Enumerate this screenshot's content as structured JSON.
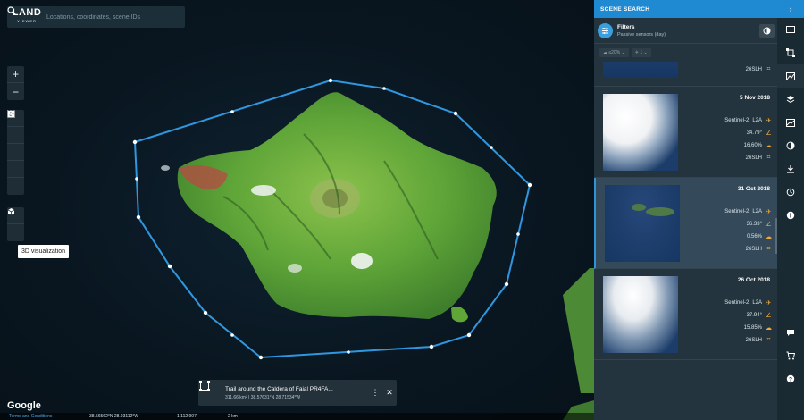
{
  "search": {
    "placeholder": "Locations, coordinates, scene IDs",
    "logo_main": "LAND",
    "logo_sub": "VIEWER"
  },
  "tooltip": "3D visualization",
  "map": {
    "google": "Google",
    "terms": "Terms and Conditions",
    "coords": "38.56562°N 28.93112°W",
    "scale": "1:112 907",
    "distance": "2 km"
  },
  "infocard": {
    "title": "Trail around the Caldera of Faial PR4FA...",
    "detail": "311.66 km² | 38.57631°N 28.71534°W"
  },
  "panel": {
    "title": "SCENE SEARCH",
    "filters_title": "Filters",
    "filters_sub": "Passive sensors (day)",
    "chip_cloud": "≤20%",
    "chip_sat": "1"
  },
  "scenes": [
    {
      "date": "",
      "tile": "26SLH"
    },
    {
      "date": "5 Nov 2018",
      "sensor": "Sentinel-2",
      "level": "L2A",
      "angle": "34.79°",
      "cloud": "16.60%",
      "tile": "26SLH"
    },
    {
      "date": "31 Oct 2018",
      "sensor": "Sentinel-2",
      "level": "L2A",
      "angle": "36.33°",
      "cloud": "0.56%",
      "tile": "26SLH"
    },
    {
      "date": "26 Oct 2018",
      "sensor": "Sentinel-2",
      "level": "L2A",
      "angle": "37.94°",
      "cloud": "15.85%",
      "tile": "26SLH"
    }
  ],
  "colors": {
    "accent": "#1f8ad1",
    "polygon": "#2f97e0",
    "vegetation": "#6fb23a"
  }
}
